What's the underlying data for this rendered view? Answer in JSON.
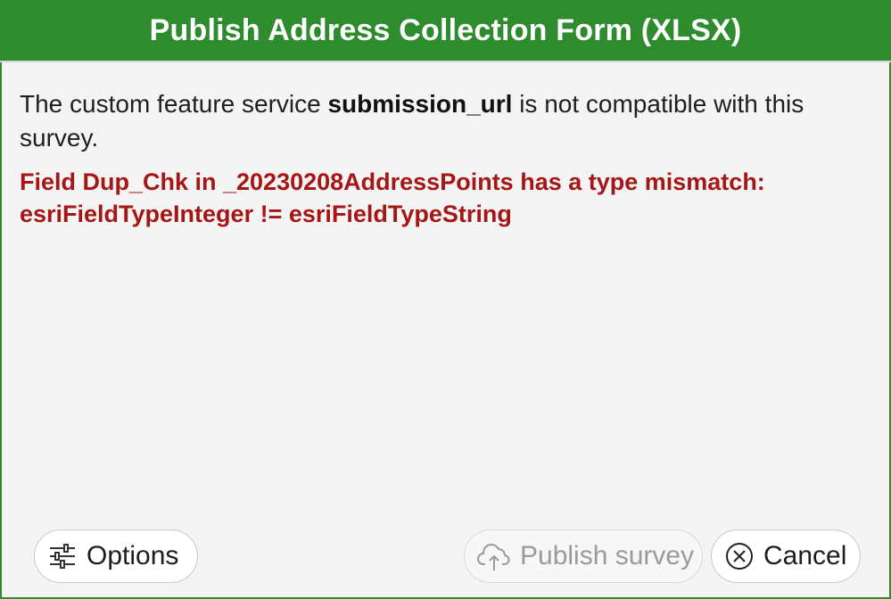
{
  "dialog": {
    "title": "Publish Address Collection Form (XLSX)",
    "message": {
      "before": "The custom feature service ",
      "field": "submission_url",
      "after_line1": " is not compatible with this",
      "after_line2": "survey."
    },
    "error": {
      "line1": "Field Dup_Chk in _20230208AddressPoints has a type mismatch:",
      "line2": "esriFieldTypeInteger != esriFieldTypeString"
    }
  },
  "buttons": {
    "options": {
      "label": "Options",
      "icon": "sliders-icon"
    },
    "publish": {
      "label": "Publish survey",
      "icon": "cloud-upload-icon",
      "enabled": false
    },
    "cancel": {
      "label": "Cancel",
      "icon": "circle-x-icon"
    }
  },
  "colors": {
    "titlebar": "#2e8b2e",
    "error_text": "#a51616",
    "background": "#f4f4f4"
  }
}
